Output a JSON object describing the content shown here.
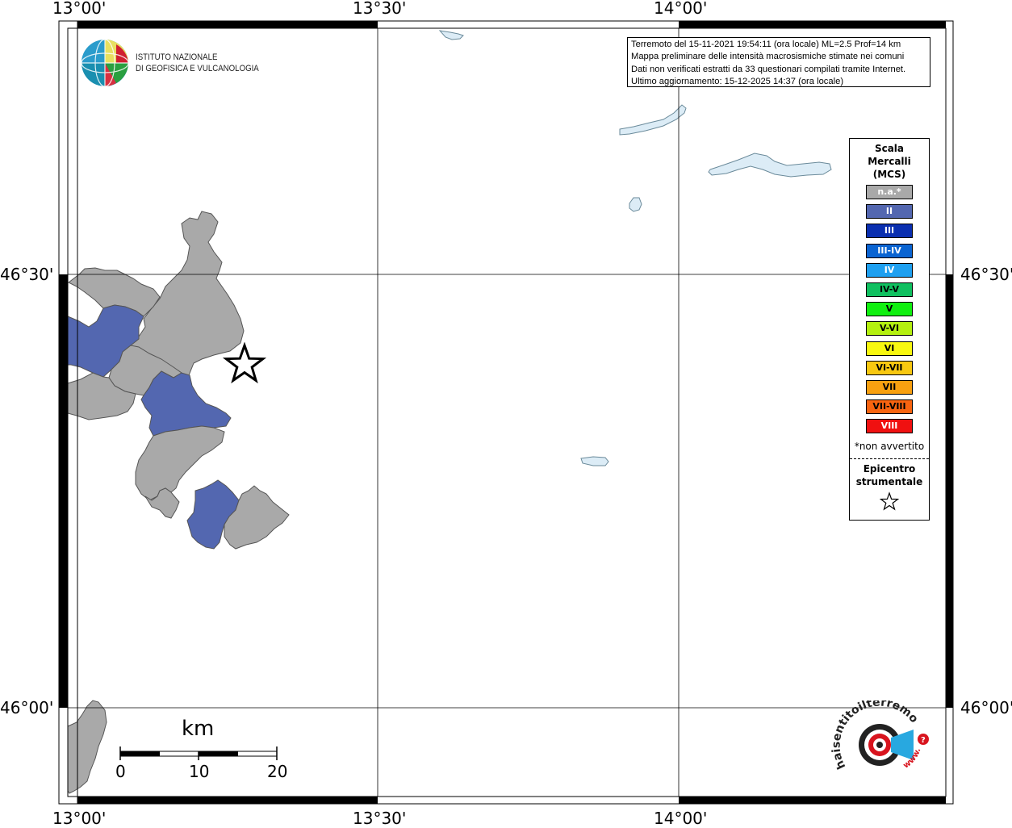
{
  "coords": {
    "top": [
      "13°00'",
      "13°30'",
      "14°00'"
    ],
    "bottom": [
      "13°00'",
      "13°30'",
      "14°00'"
    ],
    "left": [
      "46°30'",
      "46°00'"
    ],
    "right": [
      "46°30'",
      "46°00'"
    ]
  },
  "logo": {
    "line1": "ISTITUTO NAZIONALE",
    "line2": "DI GEOFISICA E VULCANOLOGIA"
  },
  "info": {
    "line1": "Terremoto del 15-11-2021 19:54:11 (ora locale) ML=2.5 Prof=14 km",
    "line2": "Mappa preliminare delle intensità macrosismiche stimate nei comuni",
    "line3": "Dati non verificati estratti da 33 questionari compilati tramite Internet.",
    "line4": "Ultimo aggiornamento: 15-12-2025 14:37 (ora locale)"
  },
  "legend": {
    "title1": "Scala",
    "title2": "Mercalli",
    "title3": "(MCS)",
    "items": [
      {
        "label": "n.a.*",
        "color": "#a9a9a9",
        "text_color": "#ffffff"
      },
      {
        "label": "II",
        "color": "#5367b0",
        "text_color": "#ffffff"
      },
      {
        "label": "III",
        "color": "#0a2fb0",
        "text_color": "#ffffff"
      },
      {
        "label": "III-IV",
        "color": "#0a64d2",
        "text_color": "#ffffff"
      },
      {
        "label": "IV",
        "color": "#1fa0f0",
        "text_color": "#ffffff"
      },
      {
        "label": "IV-V",
        "color": "#10c060",
        "text_color": "#000000"
      },
      {
        "label": "V",
        "color": "#10f010",
        "text_color": "#000000"
      },
      {
        "label": "V-VI",
        "color": "#b4f010",
        "text_color": "#000000"
      },
      {
        "label": "VI",
        "color": "#f8f810",
        "text_color": "#000000"
      },
      {
        "label": "VI-VII",
        "color": "#f8c810",
        "text_color": "#000000"
      },
      {
        "label": "VII",
        "color": "#f8a010",
        "text_color": "#000000"
      },
      {
        "label": "VII-VIII",
        "color": "#f86410",
        "text_color": "#000000"
      },
      {
        "label": "VIII",
        "color": "#f01010",
        "text_color": "#ffffff"
      }
    ],
    "note": "*non avvertito",
    "epi1": "Epicentro",
    "epi2": "strumentale"
  },
  "scalebar": {
    "unit": "km",
    "labels": [
      "0",
      "10",
      "20"
    ]
  },
  "colors": {
    "na_gray": "#a9a9a9",
    "intensity_II": "#5367b0",
    "lake": "#dcecf6",
    "lake_border": "#6a8a9a"
  },
  "watermark": {
    "text": "haisentitoilterremoto.it",
    "url": "www."
  }
}
